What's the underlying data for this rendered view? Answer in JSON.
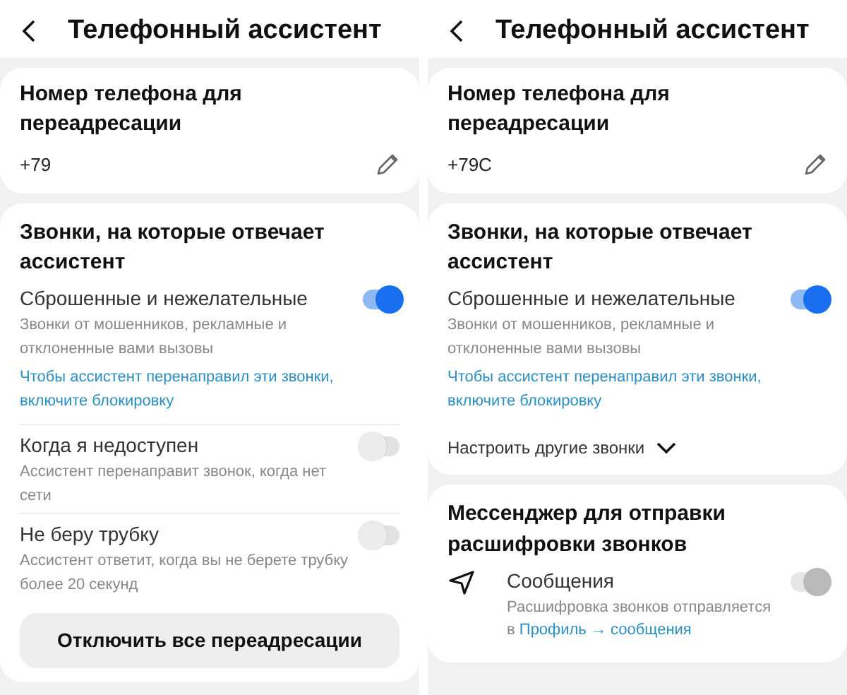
{
  "panels": [
    {
      "header": {
        "title": "Телефонный ассистент"
      },
      "number": {
        "label": "Номер телефона для переадресации",
        "value": "+79"
      },
      "calls": {
        "title": "Звонки, на которые отвечает ассистент",
        "items": [
          {
            "label": "Сброшенные и нежелательные",
            "description": "Звонки от мошенников, рекламные и отклоненные вами вызовы",
            "on": true,
            "note": "Чтобы ассистент перенаправил эти звонки, включите блокировку"
          },
          {
            "label": "Когда я недоступен",
            "description": "Ассистент перенаправит звонок, когда нет сети",
            "on": false
          },
          {
            "label": "Не беру трубку",
            "description": "Ассистент ответит, когда вы не берете трубку более 20 секунд",
            "on": false
          }
        ]
      },
      "action": {
        "label": "Отключить все переадресации"
      }
    },
    {
      "header": {
        "title": "Телефонный ассистент"
      },
      "number": {
        "label": "Номер телефона для переадресации",
        "value": "+79C"
      },
      "calls": {
        "title": "Звонки, на которые отвечает ассистент",
        "items": [
          {
            "label": "Сброшенные и нежелательные",
            "description": "Звонки от мошенников, рекламные и отклоненные вами вызовы",
            "on": true,
            "note": "Чтобы ассистент перенаправил эти звонки, включите блокировку"
          }
        ],
        "more": {
          "label": "Настроить другие звонки",
          "expanded": false
        }
      },
      "messenger": {
        "title": "Мессенджер для отправки расшифровки звонков",
        "items": [
          {
            "label": "Сообщения",
            "description": "Расшифровка звонков отправляется в",
            "link": "Профиль → сообщения",
            "on": true,
            "disabled": true
          }
        ]
      }
    }
  ]
}
